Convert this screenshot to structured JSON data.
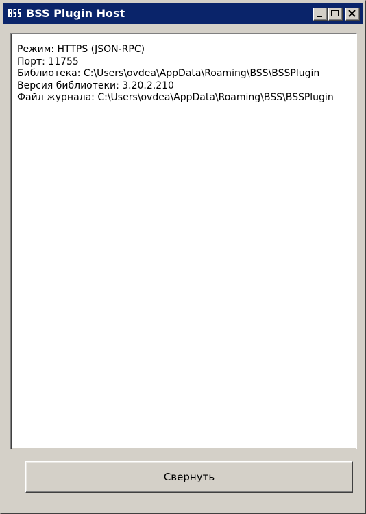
{
  "window": {
    "title": "BSS Plugin Host",
    "icon": "bss-logo-icon",
    "controls": [
      "minimize-icon",
      "maximize-icon",
      "close-icon"
    ]
  },
  "log": {
    "lines": [
      "Режим: HTTPS (JSON-RPC)",
      "Порт: 11755",
      "Библиотека: C:\\Users\\ovdea\\AppData\\Roaming\\BSS\\BSSPlugin",
      "Версия библиотеки: 3.20.2.210",
      "Файл журнала: C:\\Users\\ovdea\\AppData\\Roaming\\BSS\\BSSPlugin"
    ]
  },
  "footer": {
    "collapse_label": "Свернуть"
  },
  "colors": {
    "titlebar": "#0a246a",
    "window_face": "#d4d0c8",
    "text": "#000000"
  }
}
